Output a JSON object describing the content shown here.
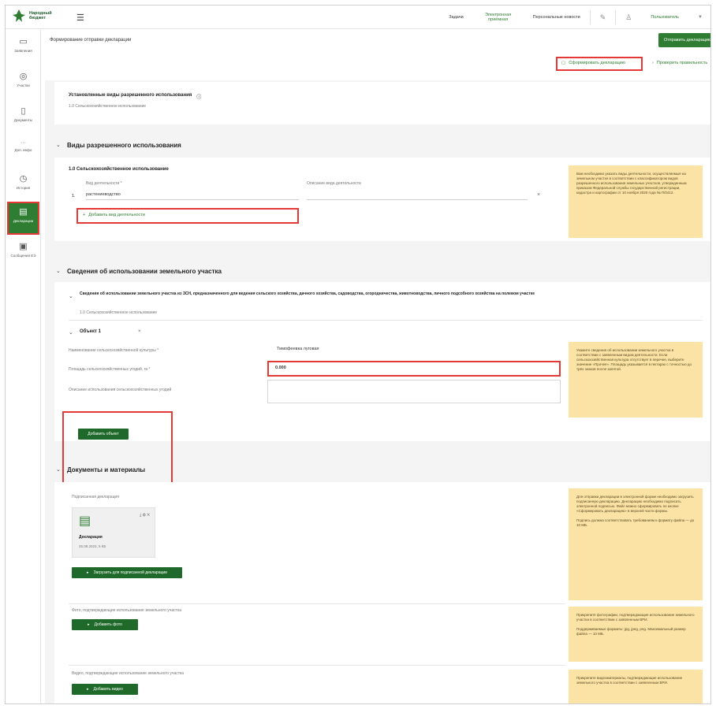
{
  "header": {
    "logo_text": "Народный бюджет",
    "links": [
      "Задачи",
      "Электронная приёмная",
      "Персональные новости"
    ],
    "user": "Пользователь"
  },
  "sidebar": {
    "items": [
      {
        "icon": "folder-icon",
        "label": "Заявления"
      },
      {
        "icon": "location-icon",
        "label": "Участки"
      },
      {
        "icon": "document-icon",
        "label": "Документы"
      },
      {
        "icon": "info-icon",
        "label": "Доп. инфо"
      },
      {
        "icon": "clock-icon",
        "label": "История"
      },
      {
        "icon": "declaration-icon",
        "label": "Декларации"
      },
      {
        "icon": "message-icon",
        "label": "Сообщения ЕЭ"
      }
    ]
  },
  "page": {
    "title": "Формирование отправки декларации",
    "send_button": "Отправить декларацию",
    "create_declaration": "Сформировать декларацию",
    "check_link": "Проверить правильность"
  },
  "established_uses": {
    "title": "Установленные виды разрешенного использования",
    "value": "1.0 Сельскохозяйственное использование"
  },
  "permitted_uses": {
    "section_title": "Виды разрешенного использования",
    "subtitle": "1.0 Сельскохозяйственное использование",
    "type_label": "Вид деятельности *",
    "type_value": "растениеводство",
    "extra_label": "Описание вида деятельности",
    "add_label": "Добавить вид деятельности",
    "note": "Вам необходимо указать виды деятельности, осуществляемые на земельном участке в соответствии с классификатором видов разрешенного использования земельных участков, утвержденным приказом Федеральной службы государственной регистрации, кадастра и картографии от 10 ноября 2020 года № П/0412."
  },
  "land_use": {
    "section_title": "Сведения об использовании земельного участка",
    "sub_title": "Сведения об использовании земельного участка из ЗСН, предназначенного для ведения сельского хозяйства, дачного хозяйства, садоводства, огородничества, животноводства, личного подсобного хозяйства на полевом участке",
    "sub_muted": "1.0 Сельскохозяйственное использование",
    "object_label": "Объект 1",
    "crop_label": "Наименование сельскохозяйственной культуры *",
    "crop_value": "Тимофеевка луговая",
    "area_label": "Площадь сельскохозяйственных угодий, га *",
    "area_value": "0.000",
    "desc_label": "Описание использования сельскохозяйственных угодий",
    "add_object": "Добавить объект",
    "note": "Укажите сведения об использовании земельного участка в соответствии с заявленным видом деятельности. Если сельскохозяйственная культура отсутствует в перечне, выберите значение «Прочее». Площадь указывается в гектарах с точностью до трёх знаков после запятой."
  },
  "documents": {
    "section_title": "Документы и материалы",
    "sign_label": "Подписанная декларация",
    "file_name": "Декларация",
    "file_meta": "25.08.2023, 5 КБ",
    "upload_signed": "Загрузить для подписанной декларации",
    "photo_label": "Фото, подтверждающие использование земельного участка",
    "photo_button": "Добавить фото",
    "video_label": "Видео, подтверждающие использование земельного участка",
    "video_button": "Добавить видео",
    "note_signed_1": "Для отправки декларации в электронной форме необходимо загрузить подписанную декларацию. Декларацию необходимо подписать электронной подписью. Файл можно сформировать по кнопке «Сформировать декларацию» в верхней части формы.",
    "note_signed_2": "Подпись должна соответствовать требованиям к формату файла — до 10 МБ.",
    "note_photo_1": "Прикрепите фотографии, подтверждающие использование земельного участка в соответствии с заявленным ВРИ.",
    "note_photo_2": "Поддерживаемые форматы: jpg, jpeg, png. Максимальный размер файла — 10 МБ.",
    "note_video": "Прикрепите видеоматериалы, подтверждающие использование земельного участка в соответствии с заявленным ВРИ."
  }
}
